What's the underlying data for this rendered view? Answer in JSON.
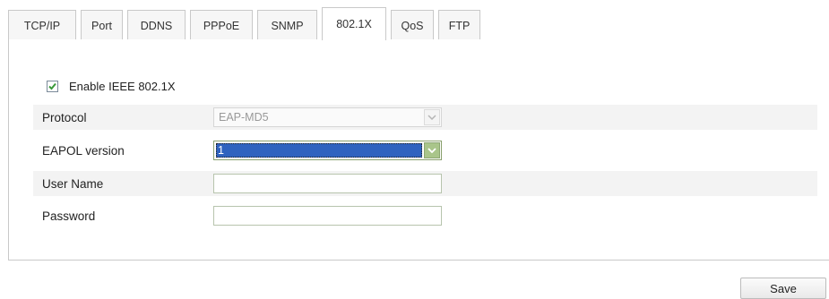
{
  "tabs": [
    {
      "label": "TCP/IP",
      "active": false
    },
    {
      "label": "Port",
      "active": false
    },
    {
      "label": "DDNS",
      "active": false
    },
    {
      "label": "PPPoE",
      "active": false
    },
    {
      "label": "SNMP",
      "active": false
    },
    {
      "label": "802.1X",
      "active": true
    },
    {
      "label": "QoS",
      "active": false
    },
    {
      "label": "FTP",
      "active": false
    }
  ],
  "enable": {
    "label": "Enable IEEE 802.1X",
    "checked": true
  },
  "form": {
    "protocol": {
      "label": "Protocol",
      "value": "EAP-MD5",
      "disabled": true
    },
    "eapol_version": {
      "label": "EAPOL version",
      "value": "1"
    },
    "user_name": {
      "label": "User Name",
      "value": ""
    },
    "password": {
      "label": "Password",
      "value": ""
    }
  },
  "save_label": "Save",
  "colors": {
    "check_mark": "#3a9a3a",
    "selection": "#2f63bf",
    "arrow_active": "#a9c58a"
  },
  "icons": {
    "checkbox": "check-icon",
    "dropdown": "chevron-down-icon"
  }
}
